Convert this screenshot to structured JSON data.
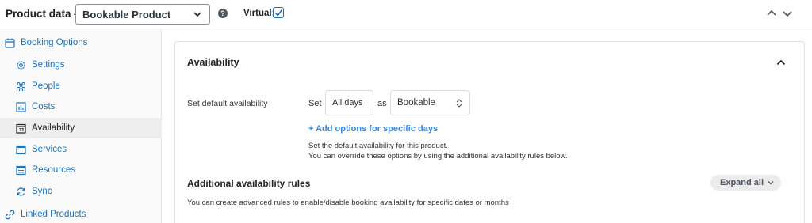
{
  "header": {
    "title": "Product data —",
    "product_type": "Bookable Product",
    "help_glyph": "?",
    "virtual_label": "Virtual:",
    "virtual_checked": true,
    "icons": [
      "chevron-down-icon",
      "help-icon",
      "checkmark-icon",
      "arrow-up-icon",
      "arrow-down-icon"
    ]
  },
  "sidebar": {
    "items": [
      {
        "label": "Booking Options",
        "icon": "calendar-icon",
        "level": "top"
      },
      {
        "label": "Settings",
        "icon": "gear-icon",
        "level": "sub"
      },
      {
        "label": "People",
        "icon": "people-icon",
        "level": "sub"
      },
      {
        "label": "Costs",
        "icon": "chart-icon",
        "level": "sub"
      },
      {
        "label": "Availability",
        "icon": "calendar-day-icon",
        "level": "sub",
        "active": true
      },
      {
        "label": "Services",
        "icon": "window-icon",
        "level": "sub"
      },
      {
        "label": "Resources",
        "icon": "window-icon",
        "level": "sub"
      },
      {
        "label": "Sync",
        "icon": "sync-icon",
        "level": "sub"
      },
      {
        "label": "Linked Products",
        "icon": "link-icon",
        "level": "top"
      }
    ]
  },
  "availability": {
    "title": "Availability",
    "default_label": "Set default availability",
    "set_word": "Set",
    "days_value": "All days",
    "as_word": "as",
    "status_value": "Bookable",
    "add_link": "+ Add options for specific days",
    "help_line_1": "Set the default availability for this product.",
    "help_line_2": "You can override these options by using the additional availability rules below.",
    "rules_title": "Additional availability rules",
    "expand_label": "Expand all",
    "rules_text": "You can create advanced rules to enable/disable booking availability for specific dates or months"
  },
  "colors": {
    "link": "#2271b1",
    "add_link": "#3a86d8",
    "sidebar_bg": "#fafafa",
    "active_bg": "#eeeeee",
    "border": "#e2e4e7"
  }
}
